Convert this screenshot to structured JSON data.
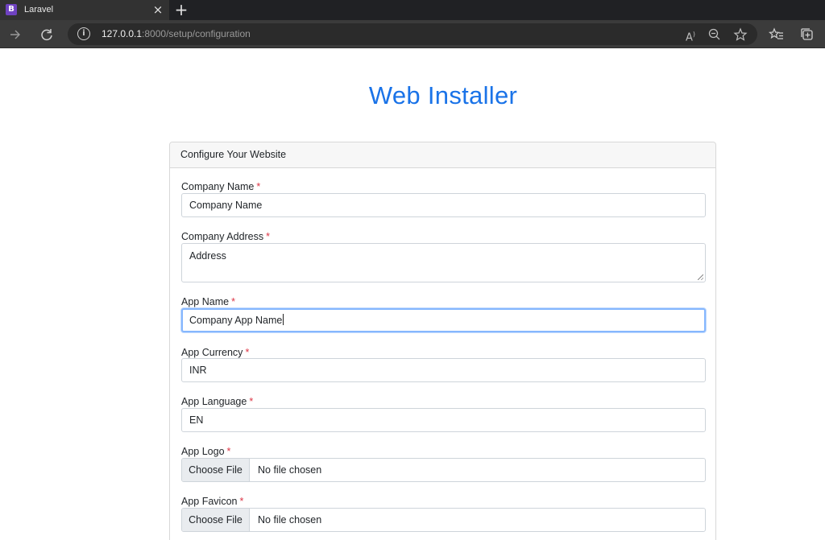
{
  "browser": {
    "tab": {
      "favicon_letter": "B",
      "title": "Laravel",
      "close": "×"
    },
    "new_tab": "+",
    "url": {
      "host": "127.0.0.1",
      "path": ":8000/setup/configuration"
    }
  },
  "page": {
    "title": "Web Installer",
    "title_color": "#1a73e8",
    "card_header": "Configure Your Website",
    "required_marker": "*",
    "fields": {
      "company_name": {
        "label": "Company Name",
        "value": "Company Name"
      },
      "company_address": {
        "label": "Company Address",
        "value": "Address"
      },
      "app_name": {
        "label": "App Name",
        "value": "Company App Name"
      },
      "app_currency": {
        "label": "App Currency",
        "value": "INR"
      },
      "app_language": {
        "label": "App Language",
        "value": "EN"
      },
      "app_logo": {
        "label": "App Logo",
        "button": "Choose File",
        "status": "No file chosen"
      },
      "app_favicon": {
        "label": "App Favicon",
        "button": "Choose File",
        "status": "No file chosen"
      }
    }
  }
}
